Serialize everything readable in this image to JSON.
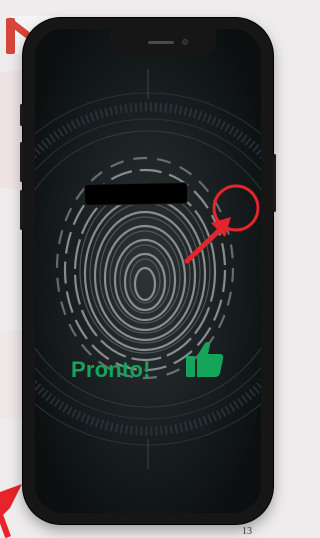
{
  "status": {
    "label": "Pronto!"
  },
  "page": {
    "number": "13"
  },
  "icons": {
    "logo": "gmail-icon",
    "status": "thumbs-up-icon",
    "pointer": "red-arrow-icon",
    "target": "red-circle-icon",
    "corner": "red-arrow-icon"
  },
  "colors": {
    "accent_green": "#14a55b",
    "highlight_red": "#e5242b",
    "gmail_red": "#d44638"
  },
  "redacted": true
}
